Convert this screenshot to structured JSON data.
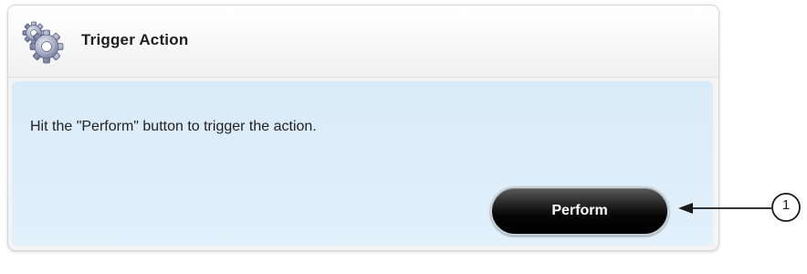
{
  "panel": {
    "title": "Trigger Action",
    "icon": "gear-icon",
    "body_text": "Hit the \"Perform\" button to trigger the action.",
    "button_label": "Perform"
  },
  "callout": {
    "number": "1"
  },
  "colors": {
    "header_bg": "#f7f7f7",
    "body_bg": "#dcedf9",
    "button_bg": "#000000",
    "button_text": "#ffffff"
  }
}
